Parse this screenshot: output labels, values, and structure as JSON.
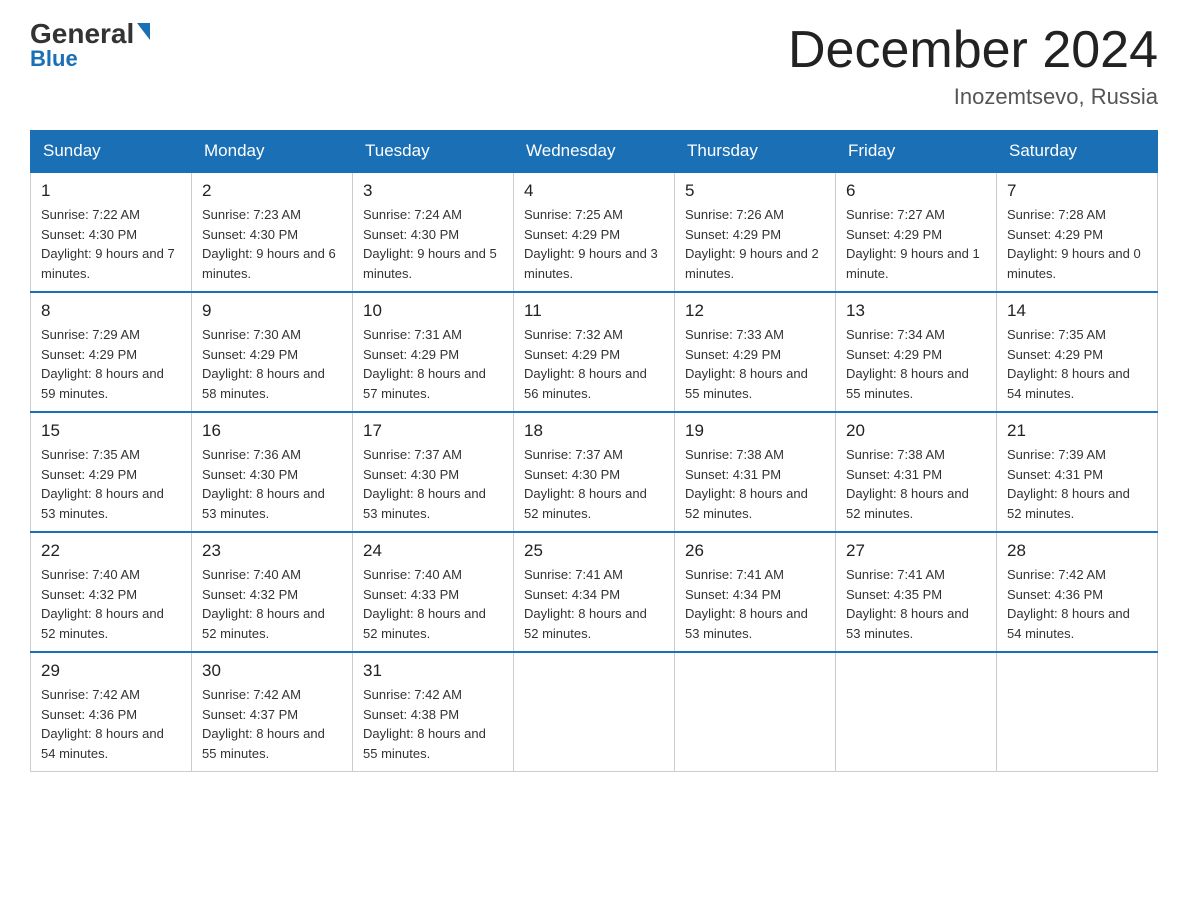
{
  "logo": {
    "text1": "General",
    "text2": "Blue"
  },
  "title": "December 2024",
  "subtitle": "Inozemtsevo, Russia",
  "days": [
    "Sunday",
    "Monday",
    "Tuesday",
    "Wednesday",
    "Thursday",
    "Friday",
    "Saturday"
  ],
  "weeks": [
    [
      {
        "date": "1",
        "sunrise": "7:22 AM",
        "sunset": "4:30 PM",
        "daylight": "9 hours and 7 minutes."
      },
      {
        "date": "2",
        "sunrise": "7:23 AM",
        "sunset": "4:30 PM",
        "daylight": "9 hours and 6 minutes."
      },
      {
        "date": "3",
        "sunrise": "7:24 AM",
        "sunset": "4:30 PM",
        "daylight": "9 hours and 5 minutes."
      },
      {
        "date": "4",
        "sunrise": "7:25 AM",
        "sunset": "4:29 PM",
        "daylight": "9 hours and 3 minutes."
      },
      {
        "date": "5",
        "sunrise": "7:26 AM",
        "sunset": "4:29 PM",
        "daylight": "9 hours and 2 minutes."
      },
      {
        "date": "6",
        "sunrise": "7:27 AM",
        "sunset": "4:29 PM",
        "daylight": "9 hours and 1 minute."
      },
      {
        "date": "7",
        "sunrise": "7:28 AM",
        "sunset": "4:29 PM",
        "daylight": "9 hours and 0 minutes."
      }
    ],
    [
      {
        "date": "8",
        "sunrise": "7:29 AM",
        "sunset": "4:29 PM",
        "daylight": "8 hours and 59 minutes."
      },
      {
        "date": "9",
        "sunrise": "7:30 AM",
        "sunset": "4:29 PM",
        "daylight": "8 hours and 58 minutes."
      },
      {
        "date": "10",
        "sunrise": "7:31 AM",
        "sunset": "4:29 PM",
        "daylight": "8 hours and 57 minutes."
      },
      {
        "date": "11",
        "sunrise": "7:32 AM",
        "sunset": "4:29 PM",
        "daylight": "8 hours and 56 minutes."
      },
      {
        "date": "12",
        "sunrise": "7:33 AM",
        "sunset": "4:29 PM",
        "daylight": "8 hours and 55 minutes."
      },
      {
        "date": "13",
        "sunrise": "7:34 AM",
        "sunset": "4:29 PM",
        "daylight": "8 hours and 55 minutes."
      },
      {
        "date": "14",
        "sunrise": "7:35 AM",
        "sunset": "4:29 PM",
        "daylight": "8 hours and 54 minutes."
      }
    ],
    [
      {
        "date": "15",
        "sunrise": "7:35 AM",
        "sunset": "4:29 PM",
        "daylight": "8 hours and 53 minutes."
      },
      {
        "date": "16",
        "sunrise": "7:36 AM",
        "sunset": "4:30 PM",
        "daylight": "8 hours and 53 minutes."
      },
      {
        "date": "17",
        "sunrise": "7:37 AM",
        "sunset": "4:30 PM",
        "daylight": "8 hours and 53 minutes."
      },
      {
        "date": "18",
        "sunrise": "7:37 AM",
        "sunset": "4:30 PM",
        "daylight": "8 hours and 52 minutes."
      },
      {
        "date": "19",
        "sunrise": "7:38 AM",
        "sunset": "4:31 PM",
        "daylight": "8 hours and 52 minutes."
      },
      {
        "date": "20",
        "sunrise": "7:38 AM",
        "sunset": "4:31 PM",
        "daylight": "8 hours and 52 minutes."
      },
      {
        "date": "21",
        "sunrise": "7:39 AM",
        "sunset": "4:31 PM",
        "daylight": "8 hours and 52 minutes."
      }
    ],
    [
      {
        "date": "22",
        "sunrise": "7:40 AM",
        "sunset": "4:32 PM",
        "daylight": "8 hours and 52 minutes."
      },
      {
        "date": "23",
        "sunrise": "7:40 AM",
        "sunset": "4:32 PM",
        "daylight": "8 hours and 52 minutes."
      },
      {
        "date": "24",
        "sunrise": "7:40 AM",
        "sunset": "4:33 PM",
        "daylight": "8 hours and 52 minutes."
      },
      {
        "date": "25",
        "sunrise": "7:41 AM",
        "sunset": "4:34 PM",
        "daylight": "8 hours and 52 minutes."
      },
      {
        "date": "26",
        "sunrise": "7:41 AM",
        "sunset": "4:34 PM",
        "daylight": "8 hours and 53 minutes."
      },
      {
        "date": "27",
        "sunrise": "7:41 AM",
        "sunset": "4:35 PM",
        "daylight": "8 hours and 53 minutes."
      },
      {
        "date": "28",
        "sunrise": "7:42 AM",
        "sunset": "4:36 PM",
        "daylight": "8 hours and 54 minutes."
      }
    ],
    [
      {
        "date": "29",
        "sunrise": "7:42 AM",
        "sunset": "4:36 PM",
        "daylight": "8 hours and 54 minutes."
      },
      {
        "date": "30",
        "sunrise": "7:42 AM",
        "sunset": "4:37 PM",
        "daylight": "8 hours and 55 minutes."
      },
      {
        "date": "31",
        "sunrise": "7:42 AM",
        "sunset": "4:38 PM",
        "daylight": "8 hours and 55 minutes."
      },
      null,
      null,
      null,
      null
    ]
  ],
  "labels": {
    "sunrise": "Sunrise:",
    "sunset": "Sunset:",
    "daylight": "Daylight:"
  }
}
